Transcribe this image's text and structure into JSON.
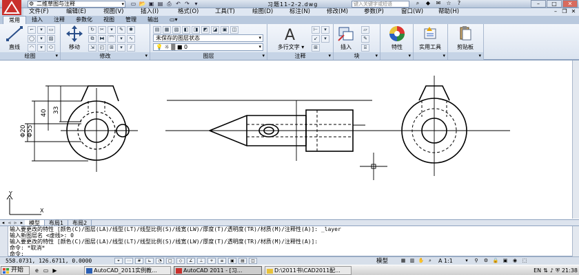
{
  "titlebar": {
    "workspace": "二维草图与注释",
    "doc_title": "习题11-2-2.dwg",
    "help_search_placeholder": "键入关键字或短语"
  },
  "menubar": {
    "items": [
      "文件(F)",
      "编辑(E)",
      "视图(V)",
      "插入(I)",
      "格式(O)",
      "工具(T)",
      "绘图(D)",
      "标注(N)",
      "修改(M)",
      "参数(P)",
      "窗口(W)",
      "帮助(H)"
    ]
  },
  "ribbon_tabs": {
    "items": [
      "常用",
      "插入",
      "注释",
      "参数化",
      "视图",
      "管理",
      "输出"
    ]
  },
  "ribbon": {
    "draw": {
      "title": "绘图",
      "line_label": "直线"
    },
    "modify": {
      "title": "修改",
      "move_label": "移动"
    },
    "layers": {
      "title": "图层",
      "layer_state": "未保存的图层状态",
      "current_layer": "0"
    },
    "annotation": {
      "title": "注释",
      "mtext_label": "多行文字"
    },
    "block": {
      "title": "块",
      "insert_label": "插入"
    },
    "properties": {
      "label": "特性"
    },
    "utilities": {
      "label": "实用工具"
    },
    "clipboard": {
      "label": "剪贴板"
    }
  },
  "drawing": {
    "dimensions": [
      "40",
      "33",
      "Φ20",
      "Φ55"
    ],
    "ucs_y": "Y",
    "ucs_x": "X"
  },
  "layout_tabs": {
    "items": [
      "模型",
      "布局1",
      "布局2"
    ]
  },
  "command": {
    "lines": [
      "输入要更改的特性 [颜色(C)/图层(LA)/线型(LT)/线型比例(S)/线宽(LW)/厚度(T)/透明度(TR)/材质(M)/注释性(A)]: _layer",
      "输入新图层名 <虚线>: 0",
      "输入要更改的特性 [颜色(C)/图层(LA)/线型(LT)/线型比例(S)/线宽(LW)/厚度(T)/透明度(TR)/材质(M)/注释性(A)]:",
      "命令: *取消*",
      "命令:"
    ]
  },
  "statusbar": {
    "coords": "558.0731, 126.6711, 0.0000",
    "model": "模型",
    "scale": "A 1:1"
  },
  "taskbar": {
    "start": "开始",
    "tasks": [
      "AutoCAD_2011实例教...",
      "AutoCAD 2011 - [习...",
      "D:\\2011书\\CAD2011配..."
    ],
    "time": "21:38"
  }
}
